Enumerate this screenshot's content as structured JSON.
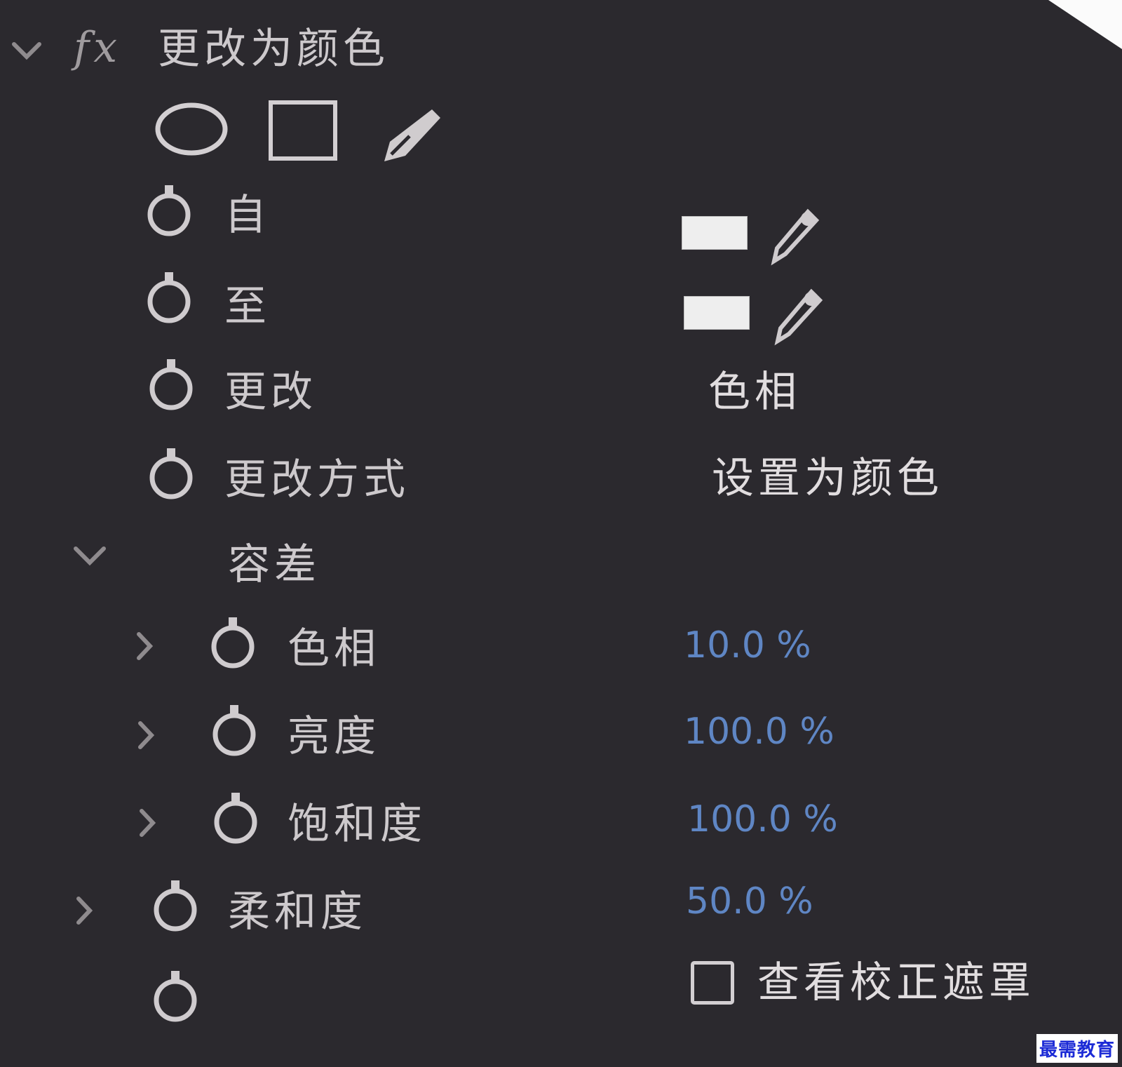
{
  "colors": {
    "panel_bg": "#2b292e",
    "label_text": "#cdc9cc",
    "value_text": "#e1dddf",
    "numeric_value": "#5f86c4",
    "swatch_fill": "#eeeeee",
    "watermark": "#1c2bd6"
  },
  "effect": {
    "fx_label": "fx",
    "title": "更改为颜色",
    "mask_tools": [
      "ellipse-mask-icon",
      "rectangle-mask-icon",
      "pen-mask-icon"
    ]
  },
  "properties": {
    "from": {
      "label": "自",
      "swatch_color": "#eeeeee"
    },
    "to": {
      "label": "至",
      "swatch_color": "#eeeeee"
    },
    "change": {
      "label": "更改",
      "value": "色相"
    },
    "change_by": {
      "label": "更改方式",
      "value": "设置为颜色"
    },
    "tolerance": {
      "label": "容差",
      "hue": {
        "label": "色相",
        "value": "10.0 %"
      },
      "lightness": {
        "label": "亮度",
        "value": "100.0 %"
      },
      "saturation": {
        "label": "饱和度",
        "value": "100.0 %"
      }
    },
    "softness": {
      "label": "柔和度",
      "value": "50.0 %"
    },
    "view_mask": {
      "label": "查看校正遮罩",
      "checked": false
    }
  },
  "watermark": "最需教育"
}
